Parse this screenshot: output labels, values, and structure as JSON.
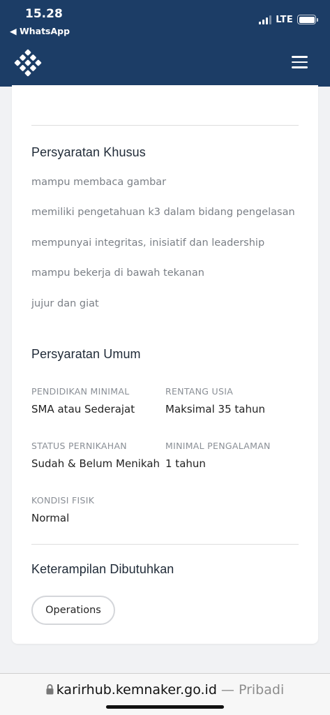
{
  "status_bar": {
    "time": "15.28",
    "back_app": "◀ WhatsApp",
    "network": "LTE"
  },
  "header": {
    "logo_icon": "kemnaker-logo-icon",
    "menu_icon": "hamburger-menu-icon",
    "color": "#1c3d66"
  },
  "special_requirements": {
    "title": "Persyaratan Khusus",
    "items": [
      "mampu membaca gambar",
      "memiliki pengetahuan k3 dalam bidang pengelasan",
      "mempunyai integritas, inisiatif dan leadership",
      "mampu bekerja di bawah tekanan",
      "jujur dan giat"
    ]
  },
  "general_requirements": {
    "title": "Persyaratan Umum",
    "fields": [
      {
        "label": "PENDIDIKAN MINIMAL",
        "value": "SMA atau Sederajat"
      },
      {
        "label": "RENTANG USIA",
        "value": "Maksimal 35 tahun"
      },
      {
        "label": "STATUS PERNIKAHAN",
        "value": "Sudah & Belum Menikah"
      },
      {
        "label": "MINIMAL PENGALAMAN",
        "value": "1 tahun"
      },
      {
        "label": "KONDISI FISIK",
        "value": "Normal"
      }
    ]
  },
  "skills": {
    "title": "Keterampilan Dibutuhkan",
    "items": [
      "Operations"
    ]
  },
  "address_bar": {
    "url": "karirhub.kemnaker.go.id",
    "mode": " — Pribadi"
  }
}
